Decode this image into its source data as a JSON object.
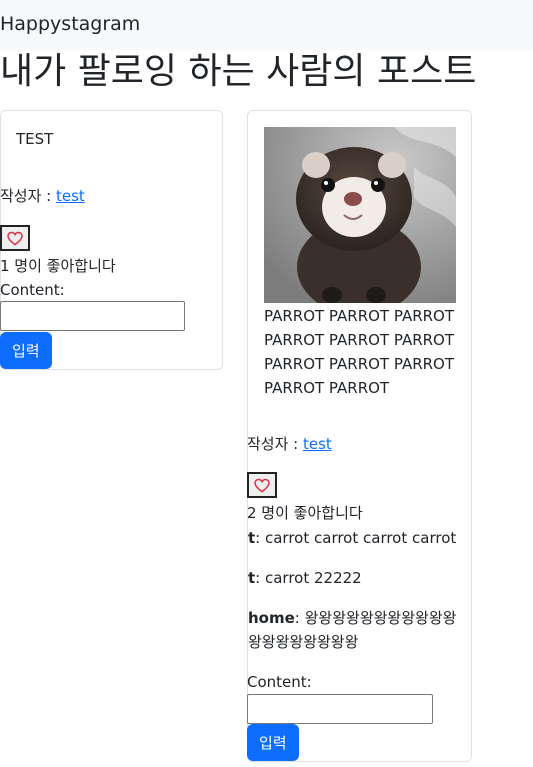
{
  "navbar": {
    "brand": "Happystagram"
  },
  "page": {
    "title": "내가 팔로잉 하는 사람의 포스트"
  },
  "posts": [
    {
      "caption": "TEST",
      "author_label": "작성자 : ",
      "author": "test",
      "likes_text": "1 명이 좋아합니다",
      "content_label": "Content:",
      "input_value": "",
      "submit_label": "입력",
      "like_icon": "heart-outline-icon",
      "comments": []
    },
    {
      "image": "ferret-photo",
      "caption": "PARROT PARROT PARROT PARROT PARROT PARROT PARROT PARROT PARROT PARROT PARROT",
      "author_label": "작성자 : ",
      "author": "test",
      "likes_text": "2 명이 좋아합니다",
      "content_label": "Content:",
      "input_value": "",
      "submit_label": "입력",
      "like_icon": "heart-outline-icon",
      "comments": [
        {
          "user": "t",
          "text": ": carrot carrot carrot carrot"
        },
        {
          "user": "t",
          "text": ": carrot 22222"
        },
        {
          "user": "home",
          "text": ": 왕왕왕왕왕왕왕왕왕왕왕왕왕왕왕왕왕왕왕"
        }
      ]
    }
  ],
  "colors": {
    "primary": "#0d6efd",
    "heart": "#dc3545",
    "navbar_bg": "#f8f9fa"
  }
}
